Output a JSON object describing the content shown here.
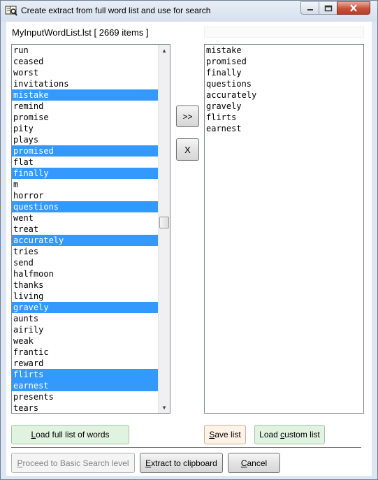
{
  "window": {
    "title": "Create extract from full word list and use for search"
  },
  "left_panel": {
    "label": "MyInputWordList.lst [ 2669 items ]",
    "items": [
      {
        "text": "run",
        "selected": false
      },
      {
        "text": "ceased",
        "selected": false
      },
      {
        "text": "worst",
        "selected": false
      },
      {
        "text": "invitations",
        "selected": false
      },
      {
        "text": "mistake",
        "selected": true
      },
      {
        "text": "remind",
        "selected": false
      },
      {
        "text": "promise",
        "selected": false
      },
      {
        "text": "pity",
        "selected": false
      },
      {
        "text": "plays",
        "selected": false
      },
      {
        "text": "promised",
        "selected": true
      },
      {
        "text": "flat",
        "selected": false
      },
      {
        "text": "finally",
        "selected": true
      },
      {
        "text": "m",
        "selected": false
      },
      {
        "text": "horror",
        "selected": false
      },
      {
        "text": "questions",
        "selected": true
      },
      {
        "text": "went",
        "selected": false
      },
      {
        "text": "treat",
        "selected": false
      },
      {
        "text": "accurately",
        "selected": true
      },
      {
        "text": "tries",
        "selected": false
      },
      {
        "text": "send",
        "selected": false
      },
      {
        "text": "halfmoon",
        "selected": false
      },
      {
        "text": "thanks",
        "selected": false
      },
      {
        "text": "living",
        "selected": false
      },
      {
        "text": "gravely",
        "selected": true
      },
      {
        "text": "aunts",
        "selected": false
      },
      {
        "text": "airily",
        "selected": false
      },
      {
        "text": "weak",
        "selected": false
      },
      {
        "text": "frantic",
        "selected": false
      },
      {
        "text": "reward",
        "selected": false
      },
      {
        "text": "flirts",
        "selected": true
      },
      {
        "text": "earnest",
        "selected": true
      },
      {
        "text": "presents",
        "selected": false
      },
      {
        "text": "tears",
        "selected": false
      }
    ]
  },
  "right_panel": {
    "label": "",
    "items": [
      "mistake",
      "promised",
      "finally",
      "questions",
      "accurately",
      "gravely",
      "flirts",
      "earnest"
    ]
  },
  "buttons": {
    "move": ">>",
    "clear": "X",
    "load_full": {
      "pre": "",
      "key": "L",
      "post": "oad full list of words"
    },
    "save_list": {
      "pre": "",
      "key": "S",
      "post": "ave list"
    },
    "load_custom": {
      "pre": "Load ",
      "key": "c",
      "post": "ustom list"
    },
    "proceed": {
      "pre": "",
      "key": "P",
      "post": "roceed to Basic Search level"
    },
    "extract": {
      "pre": "",
      "key": "E",
      "post": "xtract to clipboard"
    },
    "cancel": {
      "pre": "",
      "key": "C",
      "post": "ancel"
    }
  },
  "colors": {
    "selection": "#3399ff",
    "green_button": "#e0f3e0",
    "orange_button": "#fff2e6"
  }
}
